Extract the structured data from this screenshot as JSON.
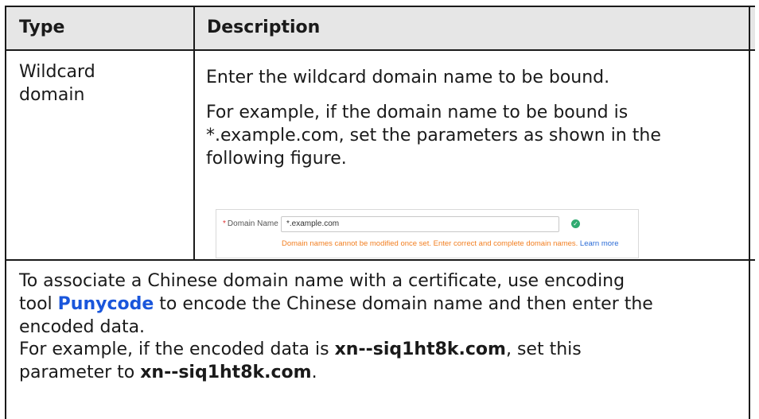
{
  "headers": {
    "type": "Type",
    "description": "Description"
  },
  "row1": {
    "type_lines": [
      "Wildcard",
      "domain"
    ],
    "desc_line1": "Enter the wildcard domain name to be bound.",
    "desc_para2_lines": [
      "For example, if the domain name to be bound is",
      "*.example.com, set the parameters as shown in the",
      "following figure."
    ]
  },
  "figure": {
    "label": "Domain Name",
    "required_mark": "*",
    "input_value": "*.example.com",
    "hint": "Domain names cannot be modified once set. Enter correct and complete domain names.",
    "learn_more": "Learn more"
  },
  "row2": {
    "para1_line1": "To associate a Chinese domain name with a certificate, use encoding",
    "para1_line2_before": "tool ",
    "para1_link": "Punycode",
    "para1_line2_after": " to encode the Chinese domain name and then enter the",
    "para1_line3": "encoded data.",
    "para2_line1_before": "For example, if the encoded data is ",
    "para2_code": "xn--siq1ht8k.com",
    "para2_line1_after": ", set this",
    "para2_line2_before": "parameter to ",
    "para2_line2_after": "."
  },
  "colors": {
    "header_bg": "#e6e6e6",
    "border": "#1a1a1a",
    "link": "#1a56db",
    "hint": "#f27f21",
    "success": "#2faa70"
  }
}
